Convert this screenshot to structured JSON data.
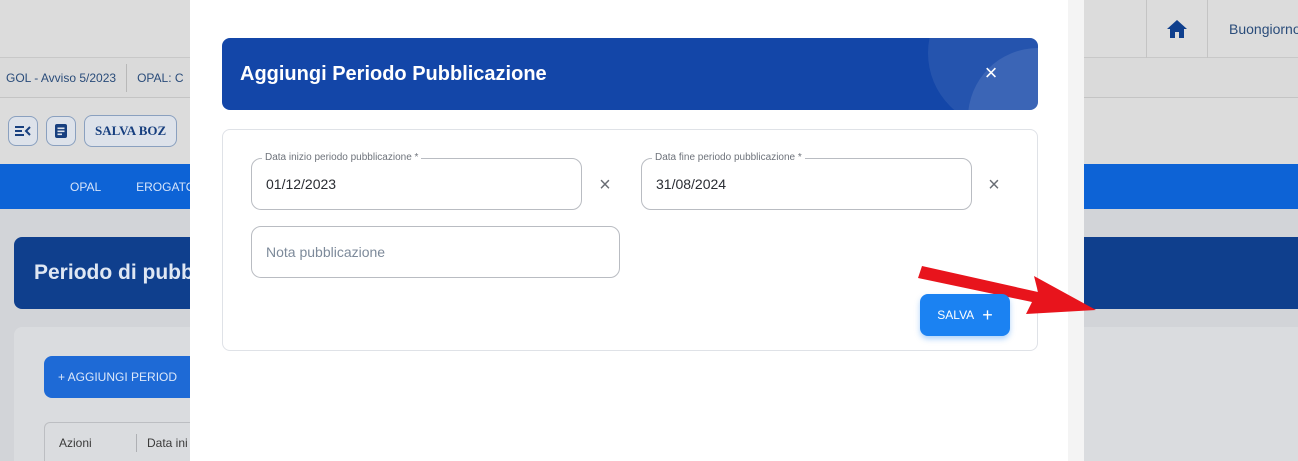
{
  "background_left": {
    "crumbs": [
      "GOL - Avviso 5/2023",
      "OPAL: C"
    ],
    "toolbar": {
      "salva_bozza": "SALVA BOZ"
    },
    "nav": [
      "OPAL",
      "EROGATO"
    ],
    "page_title": "Periodo di pubb",
    "add_button": "+  AGGIUNGI PERIOD",
    "table_headers": [
      "Azioni",
      "Data ini"
    ]
  },
  "background_right": {
    "greeting": "Buongiorno"
  },
  "modal": {
    "title": "Aggiungi Periodo Pubblicazione",
    "close_icon": "×",
    "fields": {
      "start": {
        "label": "Data inizio periodo pubblicazione *",
        "value": "01/12/2023"
      },
      "end": {
        "label": "Data fine periodo pubblicazione *",
        "value": "31/08/2024"
      },
      "note": {
        "placeholder": "Nota pubblicazione",
        "value": ""
      }
    },
    "clear_icon": "×",
    "save_button": {
      "label": "SALVA",
      "icon": "+"
    }
  },
  "colors": {
    "modal_header": "#1346a8",
    "save_button": "#1b82f2",
    "nav_blue": "#0d63d6",
    "arrow": "#e8141c"
  },
  "icons": [
    "home-icon",
    "close-icon",
    "clear-icon",
    "plus-icon",
    "menu-collapse-icon",
    "document-icon",
    "arrow-annotation"
  ]
}
